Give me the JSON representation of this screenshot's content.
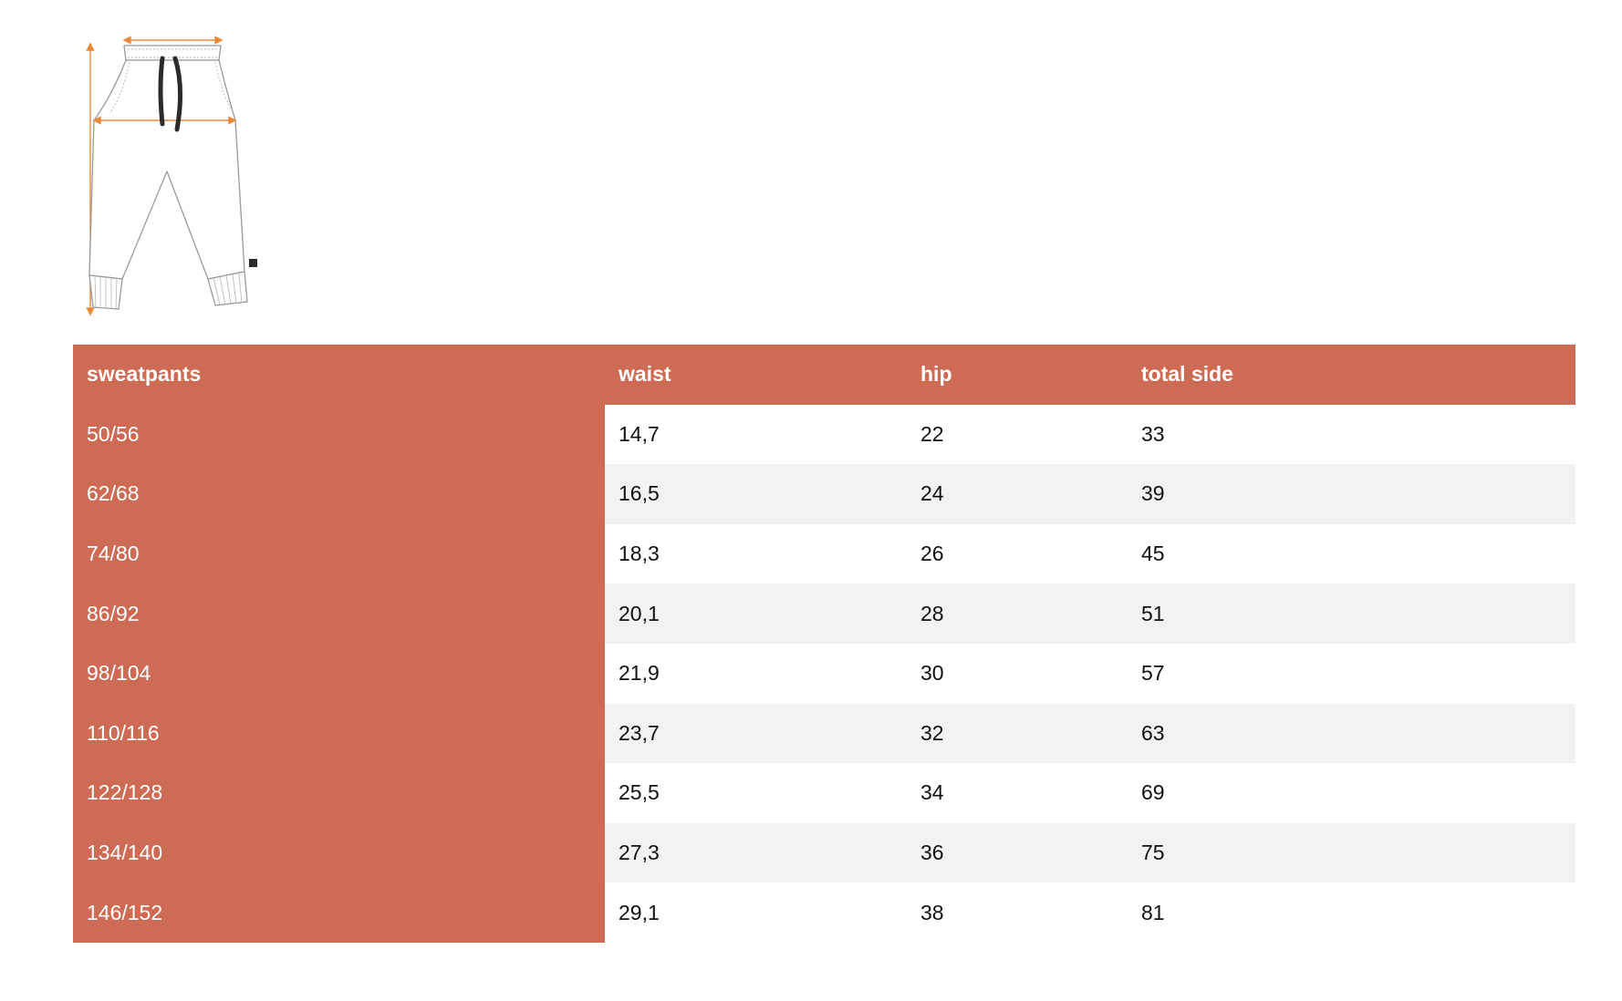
{
  "colors": {
    "accent": "#cd6b54",
    "stripe": "#f2f2f2",
    "measure_line": "#e8893a"
  },
  "illustration": {
    "icon": "sweatpants-measurement-diagram"
  },
  "table": {
    "headers": [
      "sweatpants",
      "waist",
      "hip",
      "total side"
    ],
    "rows": [
      {
        "size": "50/56",
        "waist": "14,7",
        "hip": "22",
        "total_side": "33"
      },
      {
        "size": "62/68",
        "waist": "16,5",
        "hip": "24",
        "total_side": "39"
      },
      {
        "size": "74/80",
        "waist": "18,3",
        "hip": "26",
        "total_side": "45"
      },
      {
        "size": "86/92",
        "waist": "20,1",
        "hip": "28",
        "total_side": "51"
      },
      {
        "size": "98/104",
        "waist": "21,9",
        "hip": "30",
        "total_side": "57"
      },
      {
        "size": "110/116",
        "waist": "23,7",
        "hip": "32",
        "total_side": "63"
      },
      {
        "size": "122/128",
        "waist": "25,5",
        "hip": "34",
        "total_side": "69"
      },
      {
        "size": "134/140",
        "waist": "27,3",
        "hip": "36",
        "total_side": "75"
      },
      {
        "size": "146/152",
        "waist": "29,1",
        "hip": "38",
        "total_side": "81"
      }
    ]
  }
}
